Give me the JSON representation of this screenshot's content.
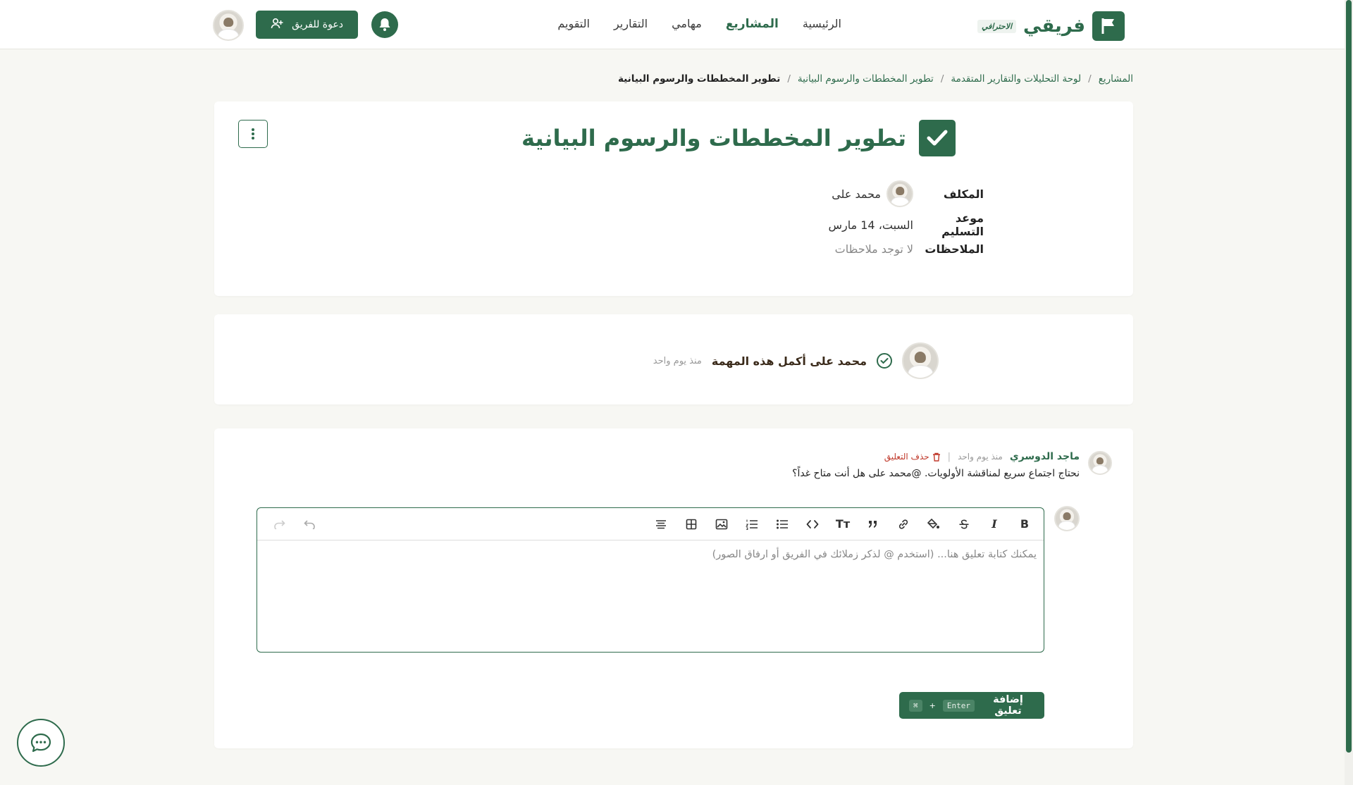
{
  "brand": {
    "name": "فريقي",
    "badge": "الاحترافي"
  },
  "nav": {
    "items": [
      {
        "label": "الرئيسية",
        "active": false
      },
      {
        "label": "المشاريع",
        "active": true
      },
      {
        "label": "مهامي",
        "active": false
      },
      {
        "label": "التقارير",
        "active": false
      },
      {
        "label": "التقويم",
        "active": false
      }
    ],
    "invite_label": "دعوة للفريق"
  },
  "breadcrumb": {
    "items": [
      "المشاريع",
      "لوحة التحليلات والتقارير المتقدمة",
      "تطوير المخططات والرسوم البيانية"
    ],
    "current": "تطوير المخططات والرسوم البيانية"
  },
  "task": {
    "title": "تطوير المخططات والرسوم البيانية",
    "assignee_label": "المكلف",
    "assignee_name": "محمد على",
    "due_label": "موعد التسليم",
    "due_value": "السبت، 14 مارس",
    "notes_label": "الملاحظات",
    "notes_value": "لا توجد ملاحظات"
  },
  "activity": {
    "text": "محمد على أكمل هذه المهمة",
    "time": "منذ يوم واحد"
  },
  "comment": {
    "author": "ماجد الدوسري",
    "time": "منذ يوم واحد",
    "delete_label": "حذف التعليق",
    "body": "نحتاج اجتماع سريع لمناقشة الأولويات. @محمد على هل أنت متاح غداً؟"
  },
  "editor": {
    "placeholder": "يمكنك كتابة تعليق هنا... (استخدم @ لذكر زملائك في الفريق أو ارفاق الصور)",
    "toolbar": [
      "bold",
      "italic",
      "strikethrough",
      "highlight",
      "link",
      "quote",
      "text-size",
      "code",
      "bullet-list",
      "ordered-list",
      "image",
      "table",
      "align"
    ],
    "bold_glyph": "B",
    "italic_glyph": "I",
    "text_size_glyph": "Tт",
    "submit_label": "إضافة تعليق",
    "shortcut_key": "Enter",
    "shortcut_mod": "⌘"
  },
  "colors": {
    "primary": "#2e6b4c",
    "danger": "#c0392b",
    "background": "#f7f7f3"
  }
}
